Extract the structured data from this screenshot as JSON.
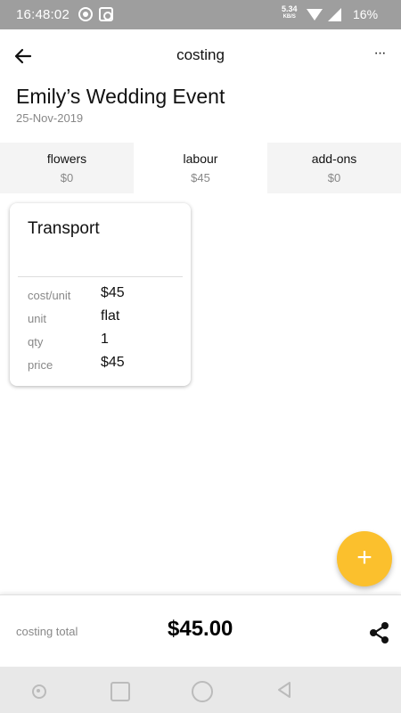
{
  "status_bar": {
    "time": "16:48:02",
    "net_speed_value": "5.34",
    "net_speed_unit": "KB/S",
    "battery": "16%",
    "icons": [
      "whatsapp-icon",
      "camera-icon",
      "wifi-icon",
      "signal-icon"
    ]
  },
  "header": {
    "title": "costing",
    "back_icon": "arrow-left-icon",
    "more_label": "···"
  },
  "event": {
    "title": "Emily’s Wedding Event",
    "date": "25-Nov-2019"
  },
  "tabs": [
    {
      "label": "flowers",
      "amount": "$0"
    },
    {
      "label": "labour",
      "amount": "$45",
      "active": true
    },
    {
      "label": "add-ons",
      "amount": "$0"
    }
  ],
  "card": {
    "title": "Transport",
    "rows": [
      {
        "key": "cost/unit",
        "value": "$45"
      },
      {
        "key": "unit",
        "value": "flat"
      },
      {
        "key": "qty",
        "value": "1"
      },
      {
        "key": "price",
        "value": "$45"
      }
    ]
  },
  "fab": {
    "label": "+",
    "color": "#fbc02d"
  },
  "summary": {
    "label": "costing total",
    "amount": "$45.00",
    "share_icon": "share-icon"
  },
  "nav": {
    "icons": [
      "dot-icon",
      "recents-icon",
      "home-icon",
      "back-triangle-icon"
    ]
  }
}
